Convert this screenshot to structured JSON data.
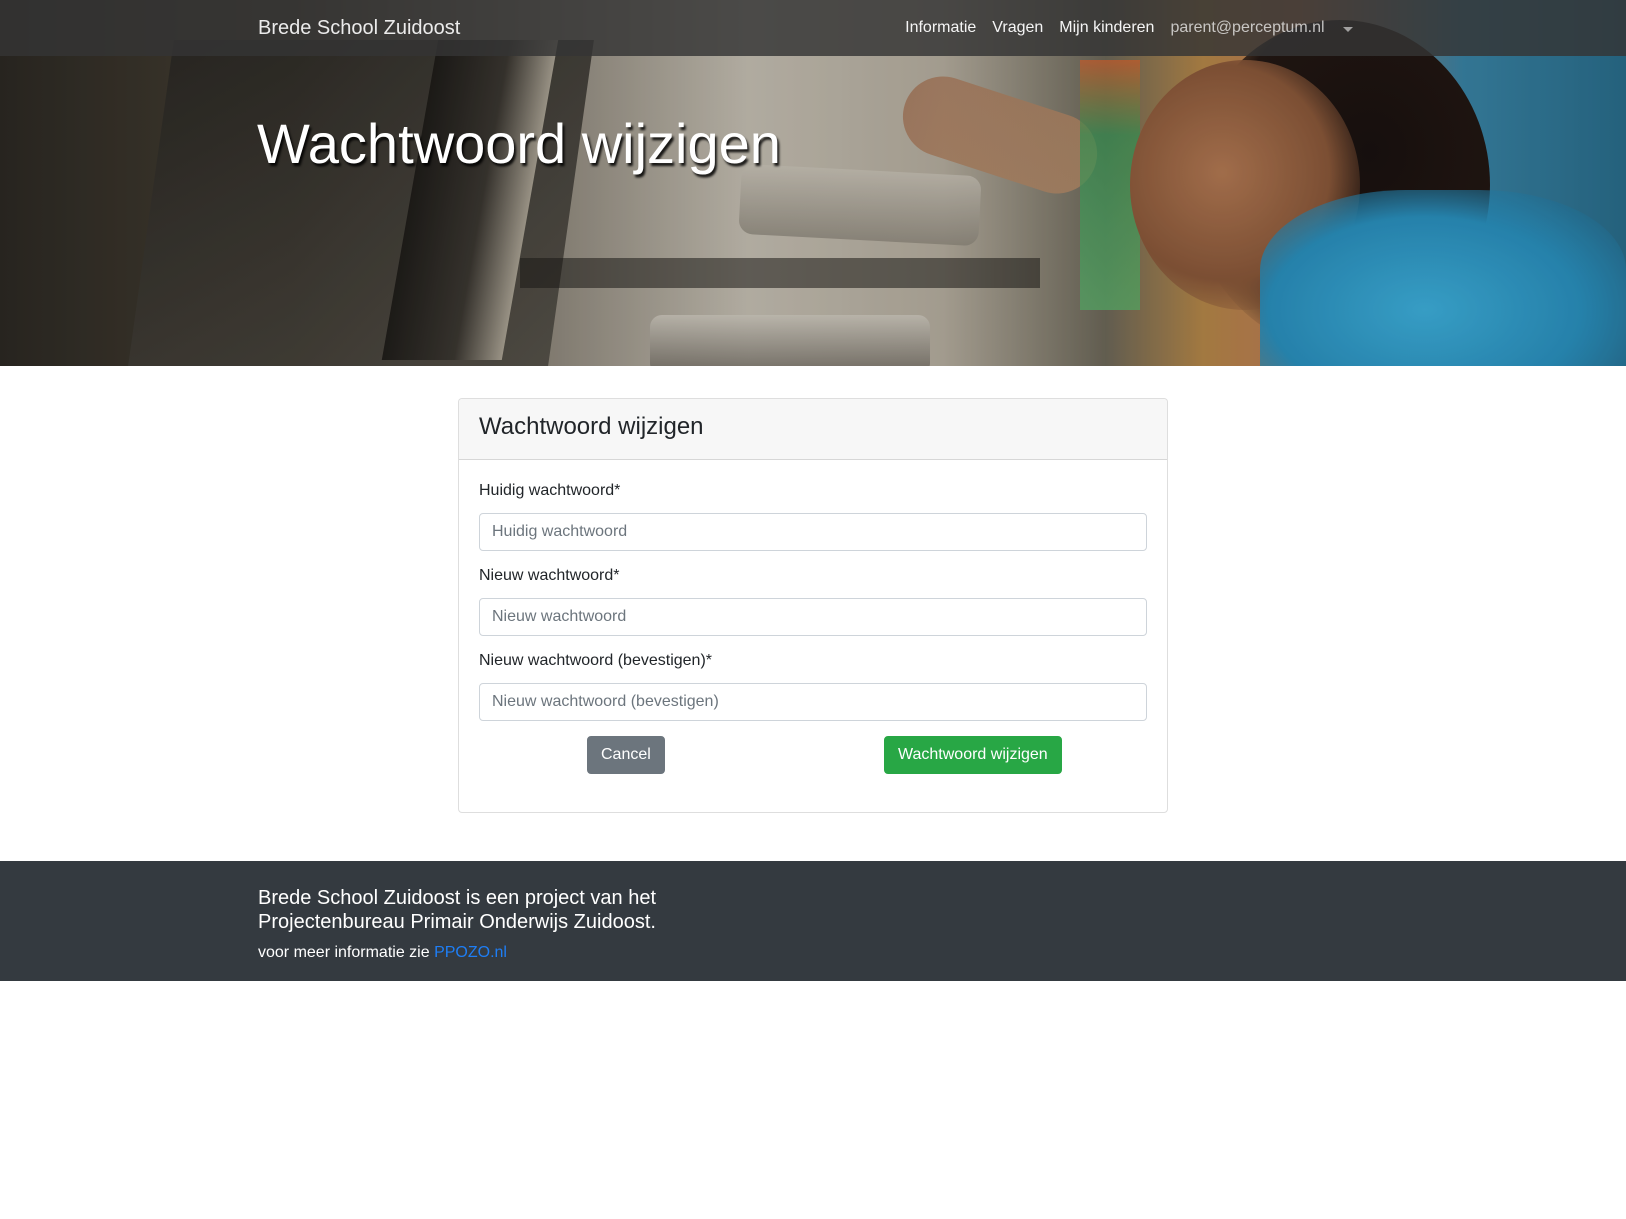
{
  "navbar": {
    "brand": "Brede School Zuidoost",
    "links": [
      {
        "label": "Informatie"
      },
      {
        "label": "Vragen"
      },
      {
        "label": "Mijn kinderen"
      }
    ],
    "user_email": "parent@perceptum.nl",
    "user_menu_icon": "caret-down-icon"
  },
  "hero": {
    "title": "Wachtwoord wijzigen"
  },
  "card": {
    "title": "Wachtwoord wijzigen",
    "fields": [
      {
        "label": "Huidig wachtwoord*",
        "placeholder": "Huidig wachtwoord",
        "value": ""
      },
      {
        "label": "Nieuw wachtwoord*",
        "placeholder": "Nieuw wachtwoord",
        "value": ""
      },
      {
        "label": "Nieuw wachtwoord (bevestigen)*",
        "placeholder": "Nieuw wachtwoord (bevestigen)",
        "value": ""
      }
    ],
    "cancel_label": "Cancel",
    "submit_label": "Wachtwoord wijzigen"
  },
  "footer": {
    "lead": "Brede School Zuidoost is een project van het Projectenbureau Primair Onderwijs Zuidoost.",
    "more_prefix": "voor meer informatie zie ",
    "link_label": "PPOZO.nl"
  },
  "colors": {
    "navbar_bg": "#343434",
    "footer_bg": "#343a40",
    "cancel_button": "#6c757d",
    "submit_button": "#28a745",
    "link": "#1e7ef5"
  }
}
